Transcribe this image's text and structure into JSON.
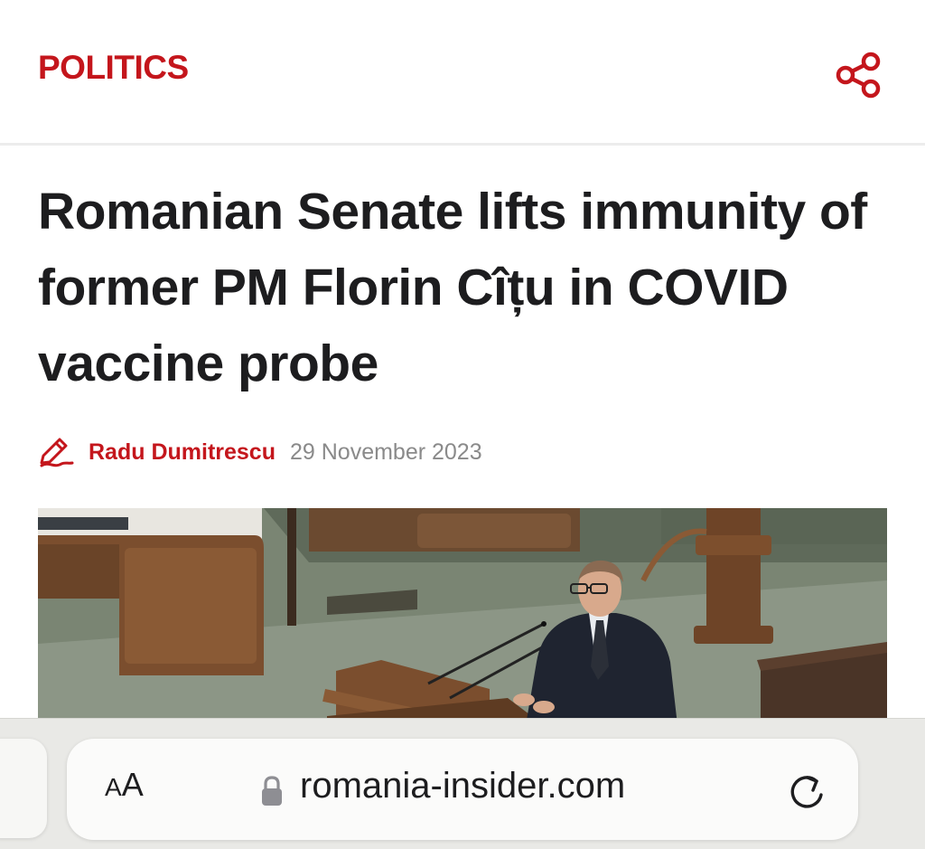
{
  "header": {
    "section": "POLITICS",
    "share_icon": "share-icon"
  },
  "article": {
    "title": "Romanian Senate lifts immunity of former PM Florin Cîțu in COVID vaccine probe",
    "author_icon": "pen-icon",
    "author": "Radu Dumitrescu",
    "date": "29 November 2023",
    "photo_alt": ""
  },
  "browser": {
    "reader_small": "A",
    "reader_big": "A",
    "lock_icon": "lock-icon",
    "url": "romania-insider.com",
    "reload_icon": "reload-icon"
  },
  "colors": {
    "accent": "#c4161c",
    "title_text": "#1d1d1f",
    "meta_text": "#8a8a8a",
    "toolbar_bg": "#e9e9e6"
  }
}
